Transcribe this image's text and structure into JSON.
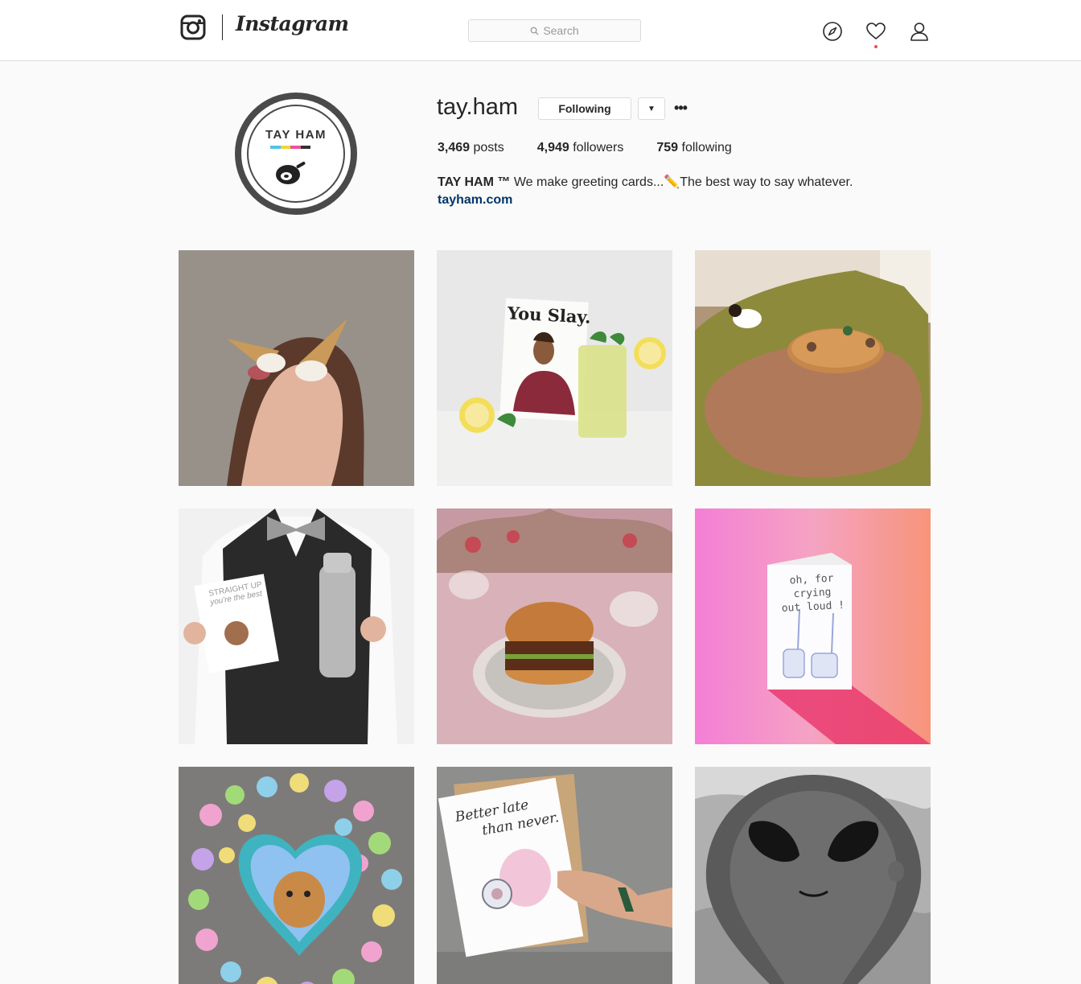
{
  "header": {
    "logo_word": "Instagram",
    "search_placeholder": "Search",
    "icons": [
      "instagram-logo-icon",
      "search-icon",
      "compass-icon",
      "heart-icon",
      "user-icon"
    ],
    "notification_color": "#ed4956"
  },
  "profile": {
    "avatar_text": "TAY HAM",
    "username": "tay.ham",
    "following_label": "Following",
    "more_label": "•••",
    "stats": {
      "posts_count": "3,469",
      "posts_label": " posts",
      "followers_count": "4,949",
      "followers_label": " followers",
      "following_count": "759",
      "following_label": " following"
    },
    "bio_name": "TAY HAM ™",
    "bio_text": " We make greeting cards...✏️The best way to say whatever.",
    "website": "tayham.com",
    "link_color": "#003569"
  },
  "posts": {
    "card_texts": {
      "you_slay": "You Slay.",
      "straight_up_1": "STRAIGHT UP",
      "straight_up_2": "you're the best",
      "crying_1": "oh, for crying",
      "crying_2": "out loud !",
      "better_late_1": "Better late",
      "better_late_2": "than never."
    }
  }
}
